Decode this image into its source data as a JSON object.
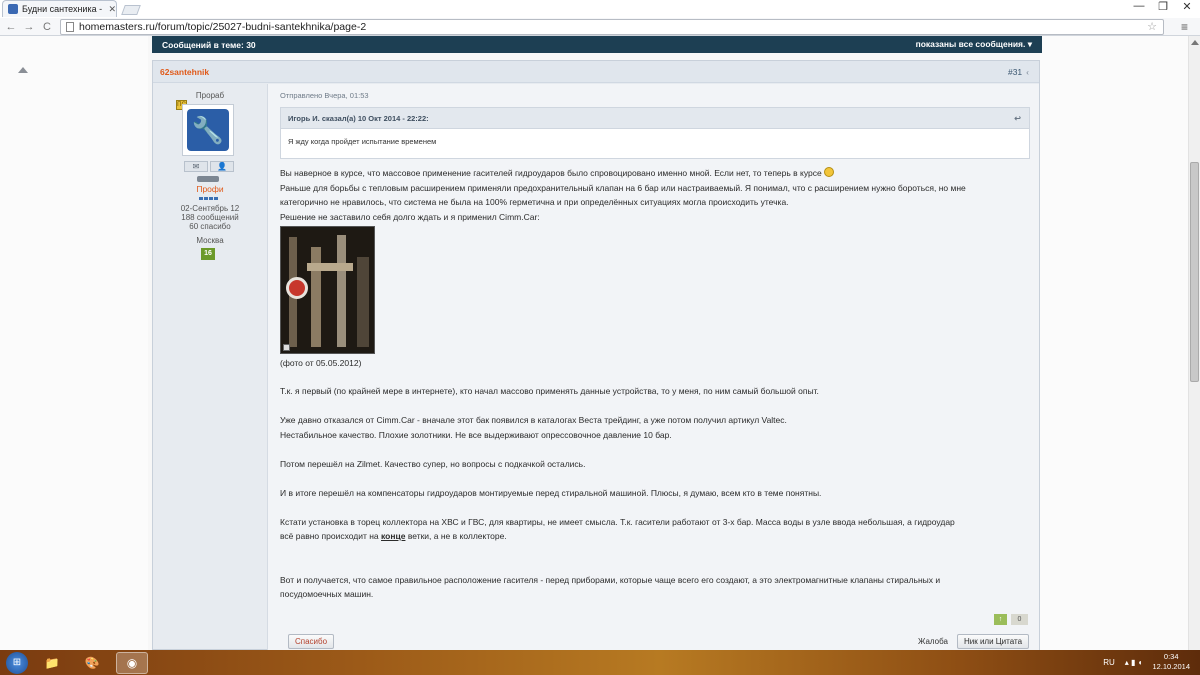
{
  "browser": {
    "tab_title": "Будни сантехника - Стра",
    "url": "homemasters.ru/forum/topic/25027-budni-santekhnika/page-2",
    "nav": {
      "back": "←",
      "forward": "→",
      "reload": "C"
    },
    "window_buttons": [
      "—",
      "❐",
      "✕"
    ]
  },
  "topbar": {
    "left": "Сообщений в теме: 30",
    "right": "показаны все сообщения. ▾"
  },
  "post": {
    "author": "62santehnik",
    "number": "#31",
    "share_icon": "‹",
    "user": {
      "rank": "Прораб",
      "badge": "ПС",
      "buttons": [
        "✉",
        "👤"
      ],
      "group": "Профи",
      "joined": "02-Сентябрь 12",
      "posts": "188 сообщений",
      "thanks": "60 спасибо",
      "city": "Москва",
      "reputation": "16"
    },
    "posted": "Отправлено Вчера, 01:53",
    "quote": {
      "header": "Игорь И. сказал(а) 10 Окт 2014 - 22:22:",
      "text": "Я жду когда пройдет испытание временем"
    },
    "body_lines": [
      "Вы наверное в курсе, что массовое применение гасителей гидроударов было спровоцировано именно мной. Если нет, то теперь в курсе",
      "Раньше для борьбы с тепловым расширением применяли предохранительный клапан на 6 бар или настраиваемый. Я понимал, что с расширением нужно бороться, но мне",
      "категорично не нравилось, что система не была на 100% герметична и при определённых ситуациях могла происходить утечка.",
      "Решение не заставило себя долго ждать и я применил Cimm.Car:"
    ],
    "photo_caption": "(фото от 05.05.2012)",
    "paragraphs": [
      "Т.к. я первый (по крайней мере в интернете), кто начал массово применять данные устройства, то у меня, по ним самый большой опыт.",
      "Уже давно отказался от Cimm.Car - вначале этот бак появился в каталогах Веста трейдинг, а уже потом получил артикул Valtec.",
      "Нестабильное качество. Плохие золотники. Не все выдерживают опрессовочное давление 10 бар.",
      "Потом перешёл на Zilmet. Качество супер, но вопросы с подкачкой остались.",
      "И в итоге перешёл на компенсаторы гидроударов монтируемые перед стиральной машиной. Плюсы, я думаю, всем кто в теме понятны.",
      "Кстати установка в торец коллектора на ХВС и ГВС, для квартиры, не имеет смысла. Т.к. гасители работают от 3-х бар. Масса воды в узле ввода небольшая, а гидроудар",
      "всё равно происходит на",
      "конце",
      "ветки, а не в коллекторе.",
      "Вот и получается, что самое правильное расположение гасителя - перед приборами, которые чаще всего его создают, а это электромагнитные клапаны стиральных и",
      "посудомоечных машин."
    ],
    "vote_up": "↑",
    "vote_count": "0",
    "thanks_button": "Спасибо",
    "report": "Жалоба",
    "quote_button": "Ник или Цитата"
  },
  "taskbar": {
    "lang": "RU",
    "time": "0:34",
    "date": "12.10.2014"
  }
}
